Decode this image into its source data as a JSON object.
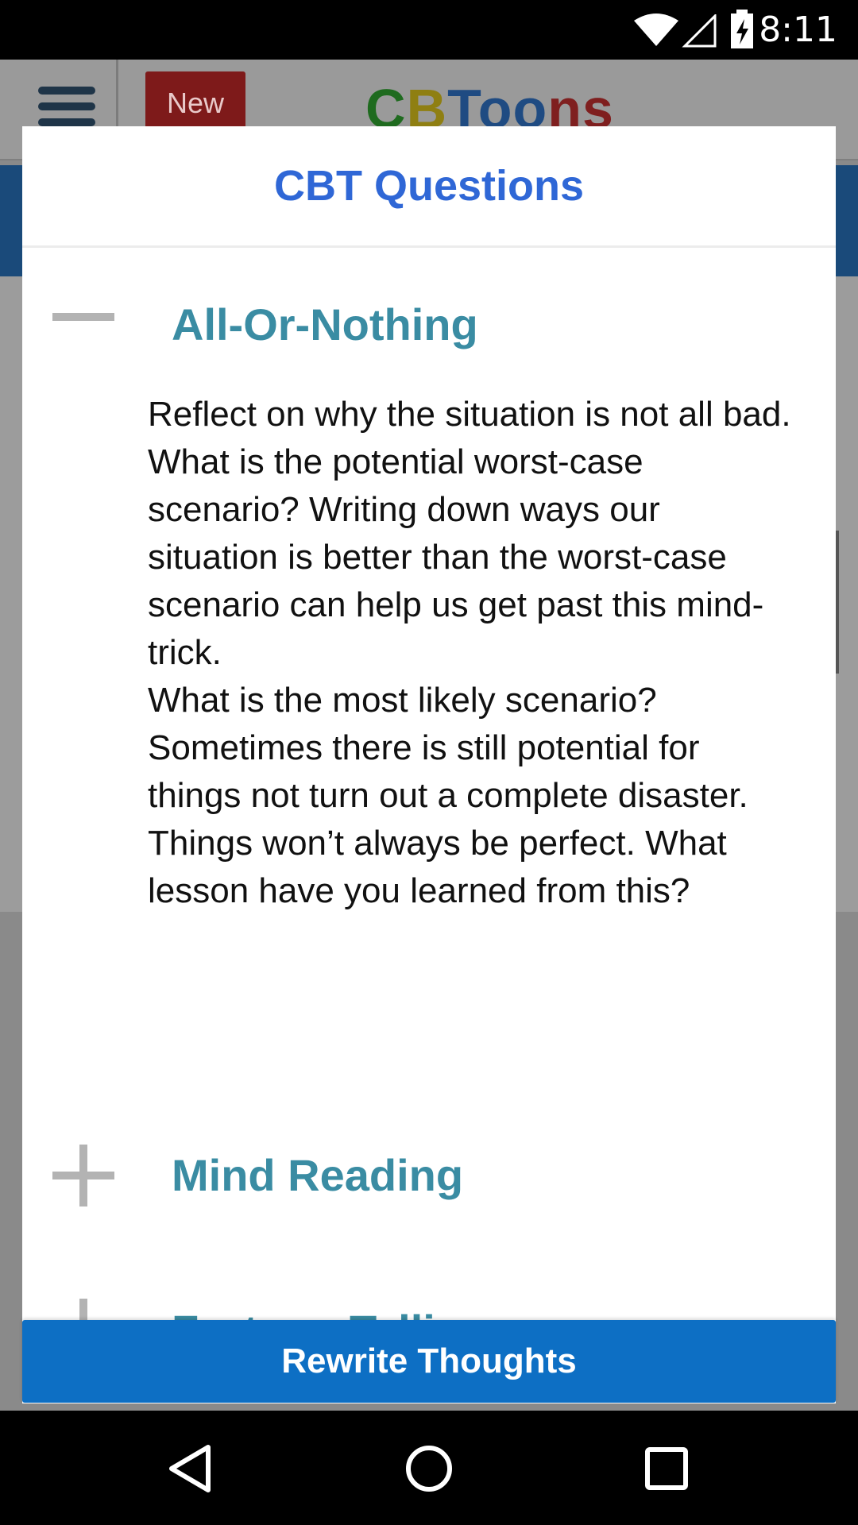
{
  "status_bar": {
    "time": "8:11",
    "icons": [
      "wifi-icon",
      "cell-signal-icon",
      "battery-charging-icon"
    ]
  },
  "app_bar": {
    "menu_icon": "hamburger-menu-icon",
    "badge": "New",
    "brand": {
      "part1": "C",
      "part2": "B",
      "part3": "Too",
      "part4": "ns"
    }
  },
  "dialog": {
    "title": "CBT Questions",
    "sections": [
      {
        "title": "All-Or-Nothing",
        "expanded": true,
        "icon": "minus-icon",
        "body": "Reflect on why the situation is not all bad. What is the potential worst-case scenario? Writing down ways our situation is better than the worst-case scenario can help us get past this mind-trick.\nWhat is the most likely scenario? Sometimes there is still potential for things not turn out a complete disaster.\nThings won’t always be perfect. What lesson have you learned from this?"
      },
      {
        "title": "Mind Reading",
        "expanded": false,
        "icon": "plus-icon"
      },
      {
        "title": "Fortune Telling",
        "expanded": false,
        "icon": "plus-icon"
      }
    ],
    "action_button": "Rewrite Thoughts"
  },
  "nav_bar": {
    "buttons": [
      "back-icon",
      "home-icon",
      "recents-icon"
    ]
  },
  "colors": {
    "title_blue": "#2f67d6",
    "section_teal": "#3a8ca3",
    "button_blue": "#0d6fc4"
  }
}
